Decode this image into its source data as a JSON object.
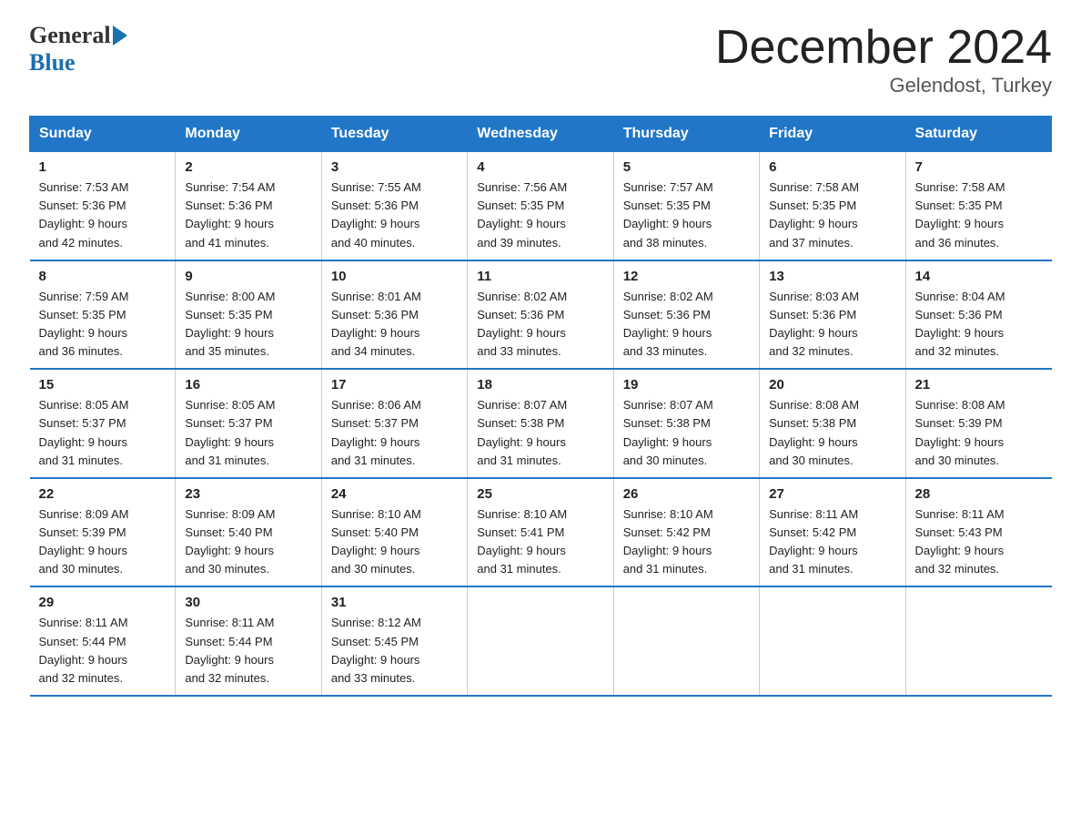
{
  "header": {
    "logo_general": "General",
    "logo_blue": "Blue",
    "title": "December 2024",
    "subtitle": "Gelendost, Turkey"
  },
  "days_of_week": [
    "Sunday",
    "Monday",
    "Tuesday",
    "Wednesday",
    "Thursday",
    "Friday",
    "Saturday"
  ],
  "weeks": [
    [
      {
        "day": "1",
        "sunrise": "7:53 AM",
        "sunset": "5:36 PM",
        "daylight": "9 hours and 42 minutes."
      },
      {
        "day": "2",
        "sunrise": "7:54 AM",
        "sunset": "5:36 PM",
        "daylight": "9 hours and 41 minutes."
      },
      {
        "day": "3",
        "sunrise": "7:55 AM",
        "sunset": "5:36 PM",
        "daylight": "9 hours and 40 minutes."
      },
      {
        "day": "4",
        "sunrise": "7:56 AM",
        "sunset": "5:35 PM",
        "daylight": "9 hours and 39 minutes."
      },
      {
        "day": "5",
        "sunrise": "7:57 AM",
        "sunset": "5:35 PM",
        "daylight": "9 hours and 38 minutes."
      },
      {
        "day": "6",
        "sunrise": "7:58 AM",
        "sunset": "5:35 PM",
        "daylight": "9 hours and 37 minutes."
      },
      {
        "day": "7",
        "sunrise": "7:58 AM",
        "sunset": "5:35 PM",
        "daylight": "9 hours and 36 minutes."
      }
    ],
    [
      {
        "day": "8",
        "sunrise": "7:59 AM",
        "sunset": "5:35 PM",
        "daylight": "9 hours and 36 minutes."
      },
      {
        "day": "9",
        "sunrise": "8:00 AM",
        "sunset": "5:35 PM",
        "daylight": "9 hours and 35 minutes."
      },
      {
        "day": "10",
        "sunrise": "8:01 AM",
        "sunset": "5:36 PM",
        "daylight": "9 hours and 34 minutes."
      },
      {
        "day": "11",
        "sunrise": "8:02 AM",
        "sunset": "5:36 PM",
        "daylight": "9 hours and 33 minutes."
      },
      {
        "day": "12",
        "sunrise": "8:02 AM",
        "sunset": "5:36 PM",
        "daylight": "9 hours and 33 minutes."
      },
      {
        "day": "13",
        "sunrise": "8:03 AM",
        "sunset": "5:36 PM",
        "daylight": "9 hours and 32 minutes."
      },
      {
        "day": "14",
        "sunrise": "8:04 AM",
        "sunset": "5:36 PM",
        "daylight": "9 hours and 32 minutes."
      }
    ],
    [
      {
        "day": "15",
        "sunrise": "8:05 AM",
        "sunset": "5:37 PM",
        "daylight": "9 hours and 31 minutes."
      },
      {
        "day": "16",
        "sunrise": "8:05 AM",
        "sunset": "5:37 PM",
        "daylight": "9 hours and 31 minutes."
      },
      {
        "day": "17",
        "sunrise": "8:06 AM",
        "sunset": "5:37 PM",
        "daylight": "9 hours and 31 minutes."
      },
      {
        "day": "18",
        "sunrise": "8:07 AM",
        "sunset": "5:38 PM",
        "daylight": "9 hours and 31 minutes."
      },
      {
        "day": "19",
        "sunrise": "8:07 AM",
        "sunset": "5:38 PM",
        "daylight": "9 hours and 30 minutes."
      },
      {
        "day": "20",
        "sunrise": "8:08 AM",
        "sunset": "5:38 PM",
        "daylight": "9 hours and 30 minutes."
      },
      {
        "day": "21",
        "sunrise": "8:08 AM",
        "sunset": "5:39 PM",
        "daylight": "9 hours and 30 minutes."
      }
    ],
    [
      {
        "day": "22",
        "sunrise": "8:09 AM",
        "sunset": "5:39 PM",
        "daylight": "9 hours and 30 minutes."
      },
      {
        "day": "23",
        "sunrise": "8:09 AM",
        "sunset": "5:40 PM",
        "daylight": "9 hours and 30 minutes."
      },
      {
        "day": "24",
        "sunrise": "8:10 AM",
        "sunset": "5:40 PM",
        "daylight": "9 hours and 30 minutes."
      },
      {
        "day": "25",
        "sunrise": "8:10 AM",
        "sunset": "5:41 PM",
        "daylight": "9 hours and 31 minutes."
      },
      {
        "day": "26",
        "sunrise": "8:10 AM",
        "sunset": "5:42 PM",
        "daylight": "9 hours and 31 minutes."
      },
      {
        "day": "27",
        "sunrise": "8:11 AM",
        "sunset": "5:42 PM",
        "daylight": "9 hours and 31 minutes."
      },
      {
        "day": "28",
        "sunrise": "8:11 AM",
        "sunset": "5:43 PM",
        "daylight": "9 hours and 32 minutes."
      }
    ],
    [
      {
        "day": "29",
        "sunrise": "8:11 AM",
        "sunset": "5:44 PM",
        "daylight": "9 hours and 32 minutes."
      },
      {
        "day": "30",
        "sunrise": "8:11 AM",
        "sunset": "5:44 PM",
        "daylight": "9 hours and 32 minutes."
      },
      {
        "day": "31",
        "sunrise": "8:12 AM",
        "sunset": "5:45 PM",
        "daylight": "9 hours and 33 minutes."
      },
      null,
      null,
      null,
      null
    ]
  ],
  "labels": {
    "sunrise": "Sunrise:",
    "sunset": "Sunset:",
    "daylight": "Daylight:"
  }
}
